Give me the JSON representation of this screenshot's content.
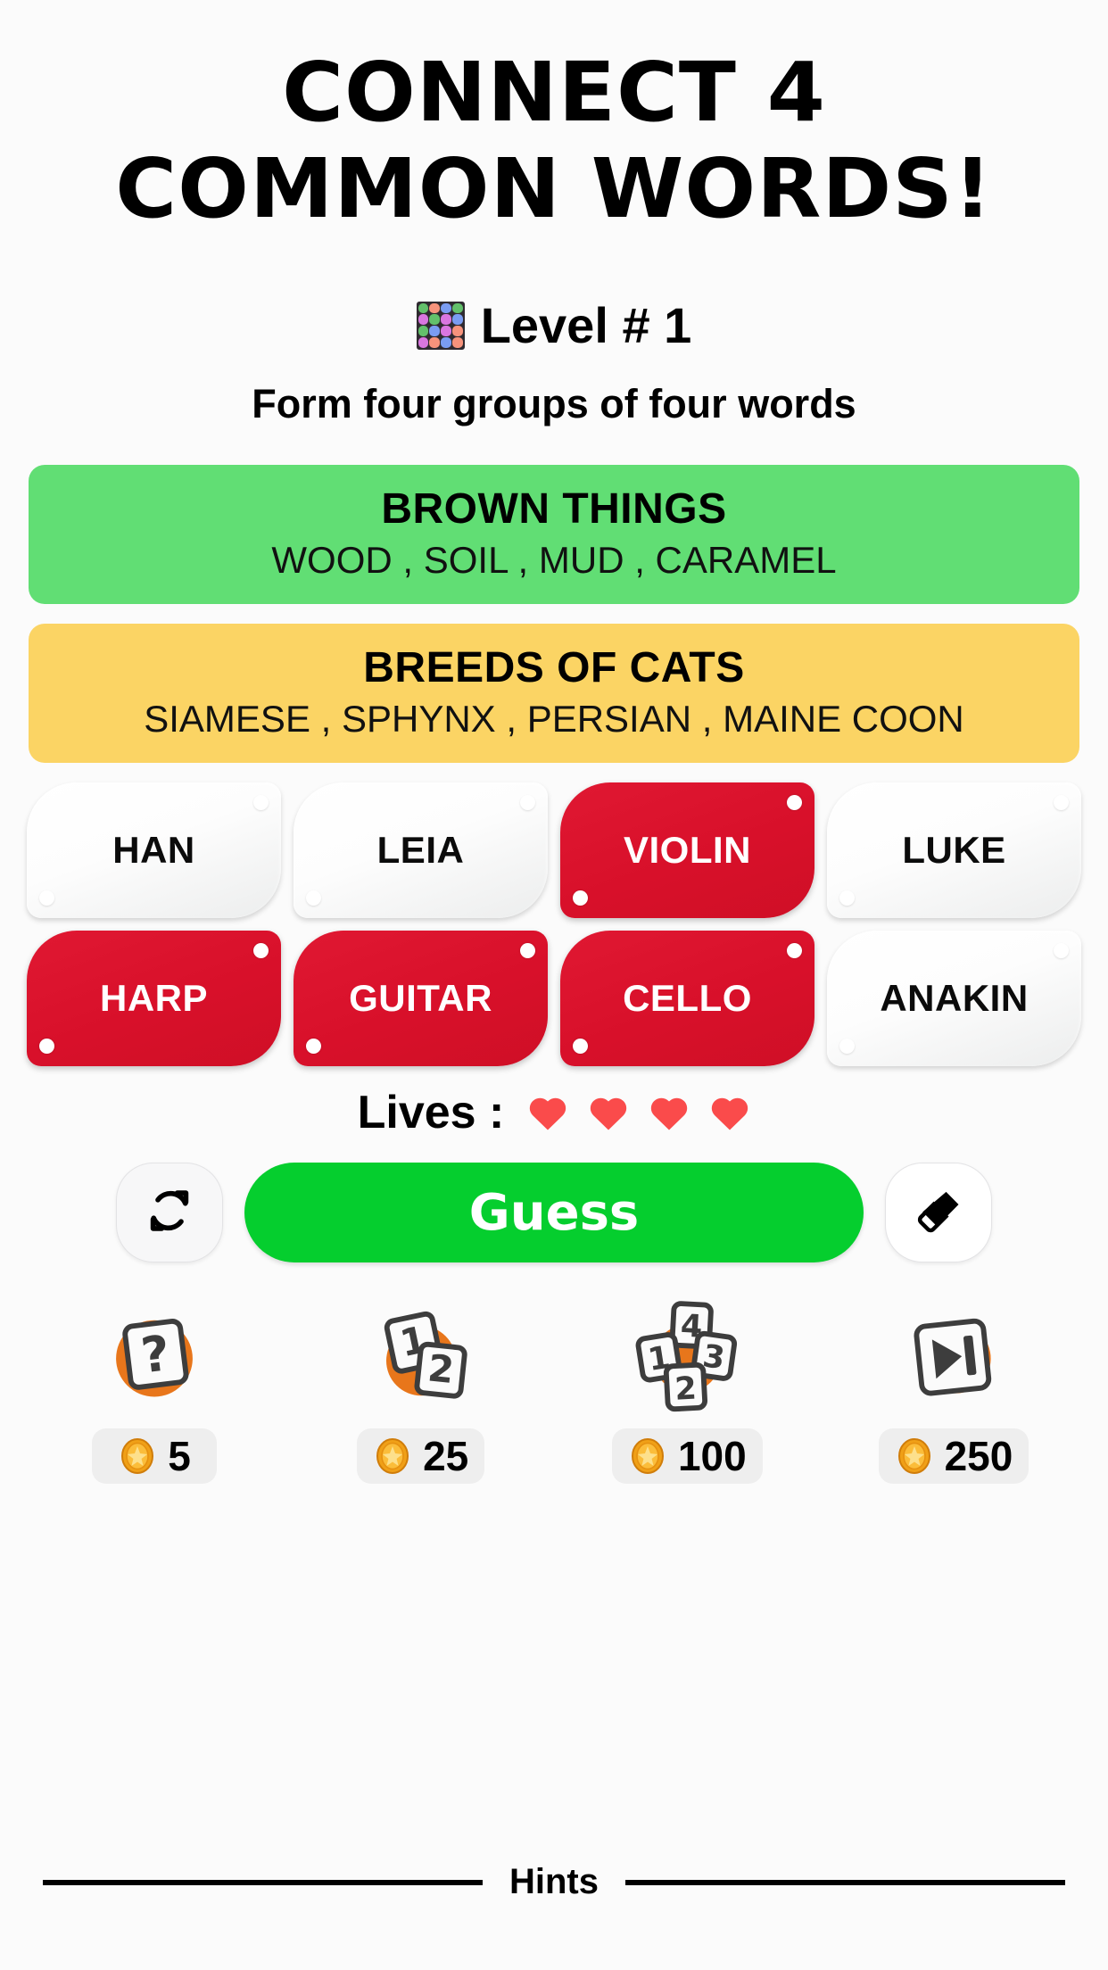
{
  "header": {
    "title_line1": "CONNECT 4",
    "title_line2": "COMMON WORDS!",
    "level_label": "Level # 1",
    "level_icon": "grid-4x4-emoji",
    "subtitle": "Form four groups of four words"
  },
  "level_grid_colors": [
    "#63c06b",
    "#f7937c",
    "#7a9cf2",
    "#63c06b",
    "#d976e0",
    "#63c06b",
    "#d976e0",
    "#7a9cf2",
    "#63c06b",
    "#7a9cf2",
    "#d976e0",
    "#f7937c",
    "#d976e0",
    "#f7937c",
    "#7a9cf2",
    "#f7937c"
  ],
  "solved_groups": [
    {
      "title": "BROWN THINGS",
      "words": "WOOD , SOIL , MUD , CARAMEL",
      "color": "#61de74"
    },
    {
      "title": "BREEDS OF CATS",
      "words": "SIAMESE , SPHYNX , PERSIAN , MAINE COON",
      "color": "#fbd464"
    }
  ],
  "board": {
    "rows": [
      [
        {
          "word": "HAN",
          "state": "unselected"
        },
        {
          "word": "LEIA",
          "state": "unselected"
        },
        {
          "word": "VIOLIN",
          "state": "selected"
        },
        {
          "word": "LUKE",
          "state": "unselected"
        }
      ],
      [
        {
          "word": "HARP",
          "state": "selected"
        },
        {
          "word": "GUITAR",
          "state": "selected"
        },
        {
          "word": "CELLO",
          "state": "selected"
        },
        {
          "word": "ANAKIN",
          "state": "unselected"
        }
      ]
    ],
    "selected_color": "#d8102a",
    "unselected_color": "#ffffff"
  },
  "lives": {
    "label": "Lives :",
    "count": 4,
    "heart_color": "#fa4b4b"
  },
  "actions": {
    "shuffle_icon": "shuffle-icon",
    "guess_label": "Guess",
    "guess_color": "#05ce2e",
    "erase_icon": "eraser-icon"
  },
  "hints": [
    {
      "icon": "question-card-icon",
      "price": "5"
    },
    {
      "icon": "two-cards-icon",
      "price": "25"
    },
    {
      "icon": "four-cards-icon",
      "price": "100"
    },
    {
      "icon": "skip-next-icon",
      "price": "250"
    }
  ],
  "footer": {
    "label": "Hints"
  }
}
